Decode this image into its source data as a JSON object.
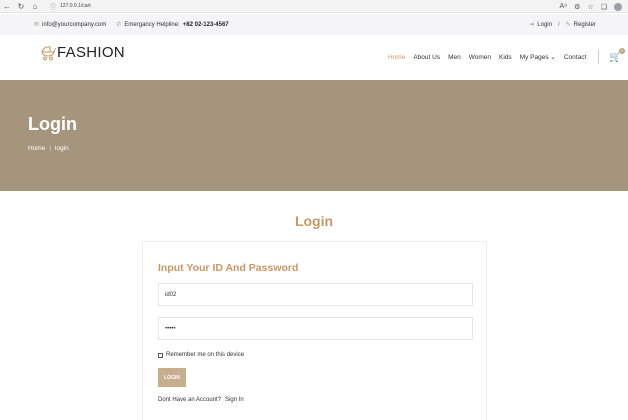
{
  "browser": {
    "url": "127.0.0.1/cart",
    "icons": [
      "back-icon",
      "refresh-icon",
      "home-icon",
      "lock-icon",
      "read-aloud-icon",
      "extension-icon",
      "favorites-icon",
      "collections-icon",
      "profile-icon"
    ]
  },
  "topbar": {
    "email": "info@yourcompany.com",
    "helpline_label": "Emergancy Helpline:",
    "helpline_number": "+82 02-123-4567",
    "login": "Login",
    "separator": "/",
    "register": "Register"
  },
  "header": {
    "logo_text": "FASHION",
    "menu": {
      "home": "Home",
      "about": "About Us",
      "men": "Men",
      "women": "Women",
      "kids": "Kids",
      "my_pages": "My Pages",
      "contact": "Contact"
    },
    "cart_count": "0"
  },
  "banner": {
    "title": "Login",
    "breadcrumb_home": "Home",
    "breadcrumb_sep": "|",
    "breadcrumb_current": "login"
  },
  "main": {
    "section_title": "Login",
    "card_title": "Input Your ID And Password",
    "id_value": "id02",
    "password_value": "•••••",
    "remember_label": "Remember me on this device",
    "login_button": "LOGIN",
    "no_account_text": "Dont Have an Account?",
    "sign_in_link": "Sign In"
  },
  "colors": {
    "accent": "#c4996a",
    "banner": "#a5957c",
    "button": "#c7ae8e",
    "topbar_bg": "#f5f5f7"
  }
}
